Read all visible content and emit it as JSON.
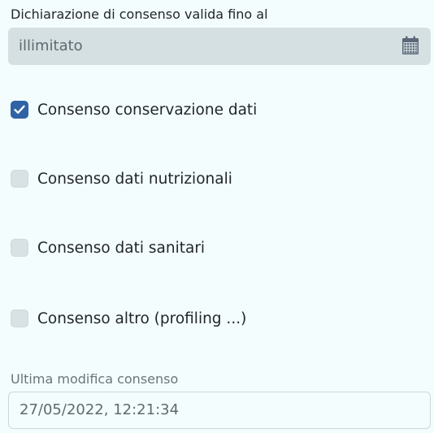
{
  "consent_until": {
    "label": "Dichiarazione di consenso valida fino al",
    "value": "illimitato",
    "icon": "calendar-icon"
  },
  "consents": [
    {
      "label": "Consenso conservazione dati",
      "checked": true
    },
    {
      "label": "Consenso dati nutrizionali",
      "checked": false
    },
    {
      "label": "Consenso dati sanitari",
      "checked": false
    },
    {
      "label": "Consenso altro (profiling ...)",
      "checked": false
    }
  ],
  "last_modified": {
    "label": "Ultima modifica consenso",
    "value": "27/05/2022, 12:21:34"
  },
  "colors": {
    "background": "#f4fdfd",
    "checked": "#2f63a6",
    "disabled_field": "#d5e0e3"
  }
}
